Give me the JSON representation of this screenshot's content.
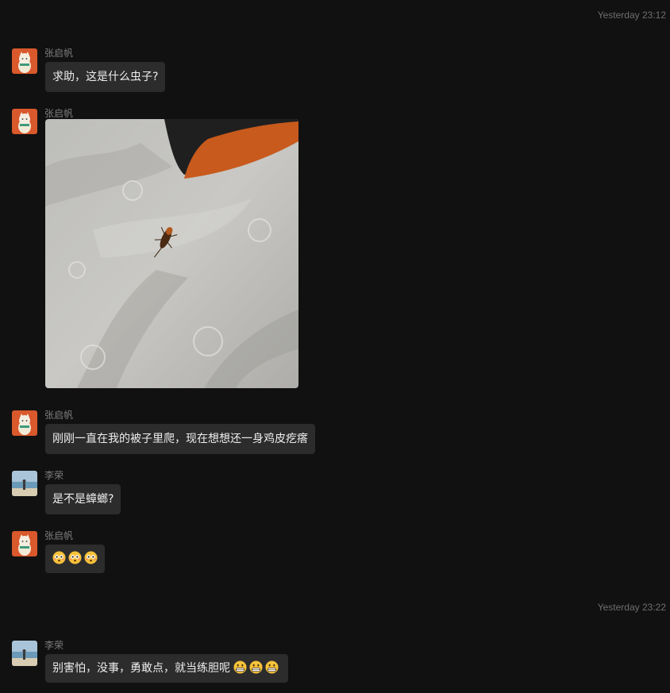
{
  "timestamps": [
    "Yesterday 23:12",
    "Yesterday 23:22"
  ],
  "messages": [
    {
      "sender": "张启帆",
      "text": "求助，这是什么虫子?"
    },
    {
      "sender": "张启帆",
      "type": "image"
    },
    {
      "sender": "张启帆",
      "text": "刚刚一直在我的被子里爬，现在想想还一身鸡皮疙瘩"
    },
    {
      "sender": "李荣",
      "text": "是不是蟑螂?"
    },
    {
      "sender": "张启帆",
      "emojis": [
        "flushed-face",
        "flushed-face",
        "flushed-face"
      ]
    },
    {
      "sender": "李荣",
      "text": "别害怕，没事，勇敢点，就当练胆呢",
      "emojis": [
        "grinning-face",
        "grinning-face",
        "grinning-face"
      ]
    }
  ],
  "colors": {
    "background": "#111111",
    "bubble": "#2c2c2c",
    "text": "#ededed",
    "meta": "#7d7d7d"
  }
}
